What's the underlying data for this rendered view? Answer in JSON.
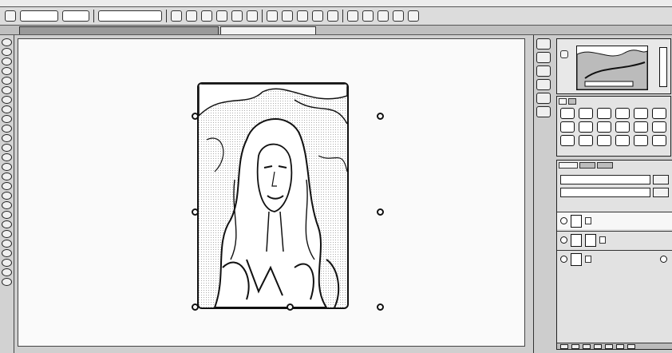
{
  "menu": {
    "items": [
      "",
      "",
      "",
      "",
      "",
      "",
      "",
      "",
      "",
      "",
      "",
      ""
    ]
  },
  "options": {
    "field1": "",
    "field2": "",
    "field3": ""
  },
  "tabs": [
    {
      "label": ""
    },
    {
      "label": ""
    }
  ],
  "layers": {
    "blend_mode": "",
    "opacity": "",
    "rows": [
      {
        "name": ""
      },
      {
        "name": ""
      },
      {
        "name": ""
      }
    ]
  },
  "panel_tabs": {
    "color": [
      "",
      ""
    ]
  },
  "icons": [
    "move-icon",
    "marquee-icon",
    "lasso-icon",
    "crop-icon",
    "eyedropper-icon",
    "brush-icon",
    "stamp-icon",
    "eraser-icon",
    "gradient-icon",
    "dodge-icon",
    "pen-icon",
    "type-icon",
    "shape-icon",
    "hand-icon",
    "zoom-icon"
  ]
}
